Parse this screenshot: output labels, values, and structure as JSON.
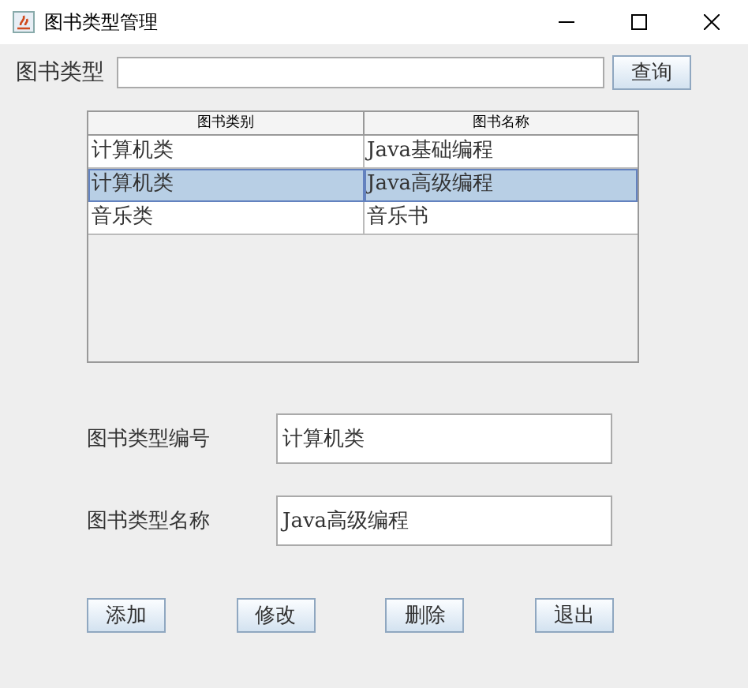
{
  "window": {
    "title": "图书类型管理"
  },
  "search": {
    "label": "图书类型",
    "button": "查询"
  },
  "table": {
    "columns": [
      "图书类别",
      "图书名称"
    ],
    "rows": [
      {
        "cells": [
          "计算机类",
          "Java基础编程"
        ],
        "selected": false
      },
      {
        "cells": [
          "计算机类",
          "Java高级编程"
        ],
        "selected": true
      },
      {
        "cells": [
          "音乐类",
          "音乐书"
        ],
        "selected": false
      }
    ]
  },
  "form": [
    {
      "label": "图书类型编号",
      "value": "计算机类"
    },
    {
      "label": "图书类型名称",
      "value": "Java高级编程"
    }
  ],
  "buttons": [
    "添加",
    "修改",
    "删除",
    "退出"
  ]
}
